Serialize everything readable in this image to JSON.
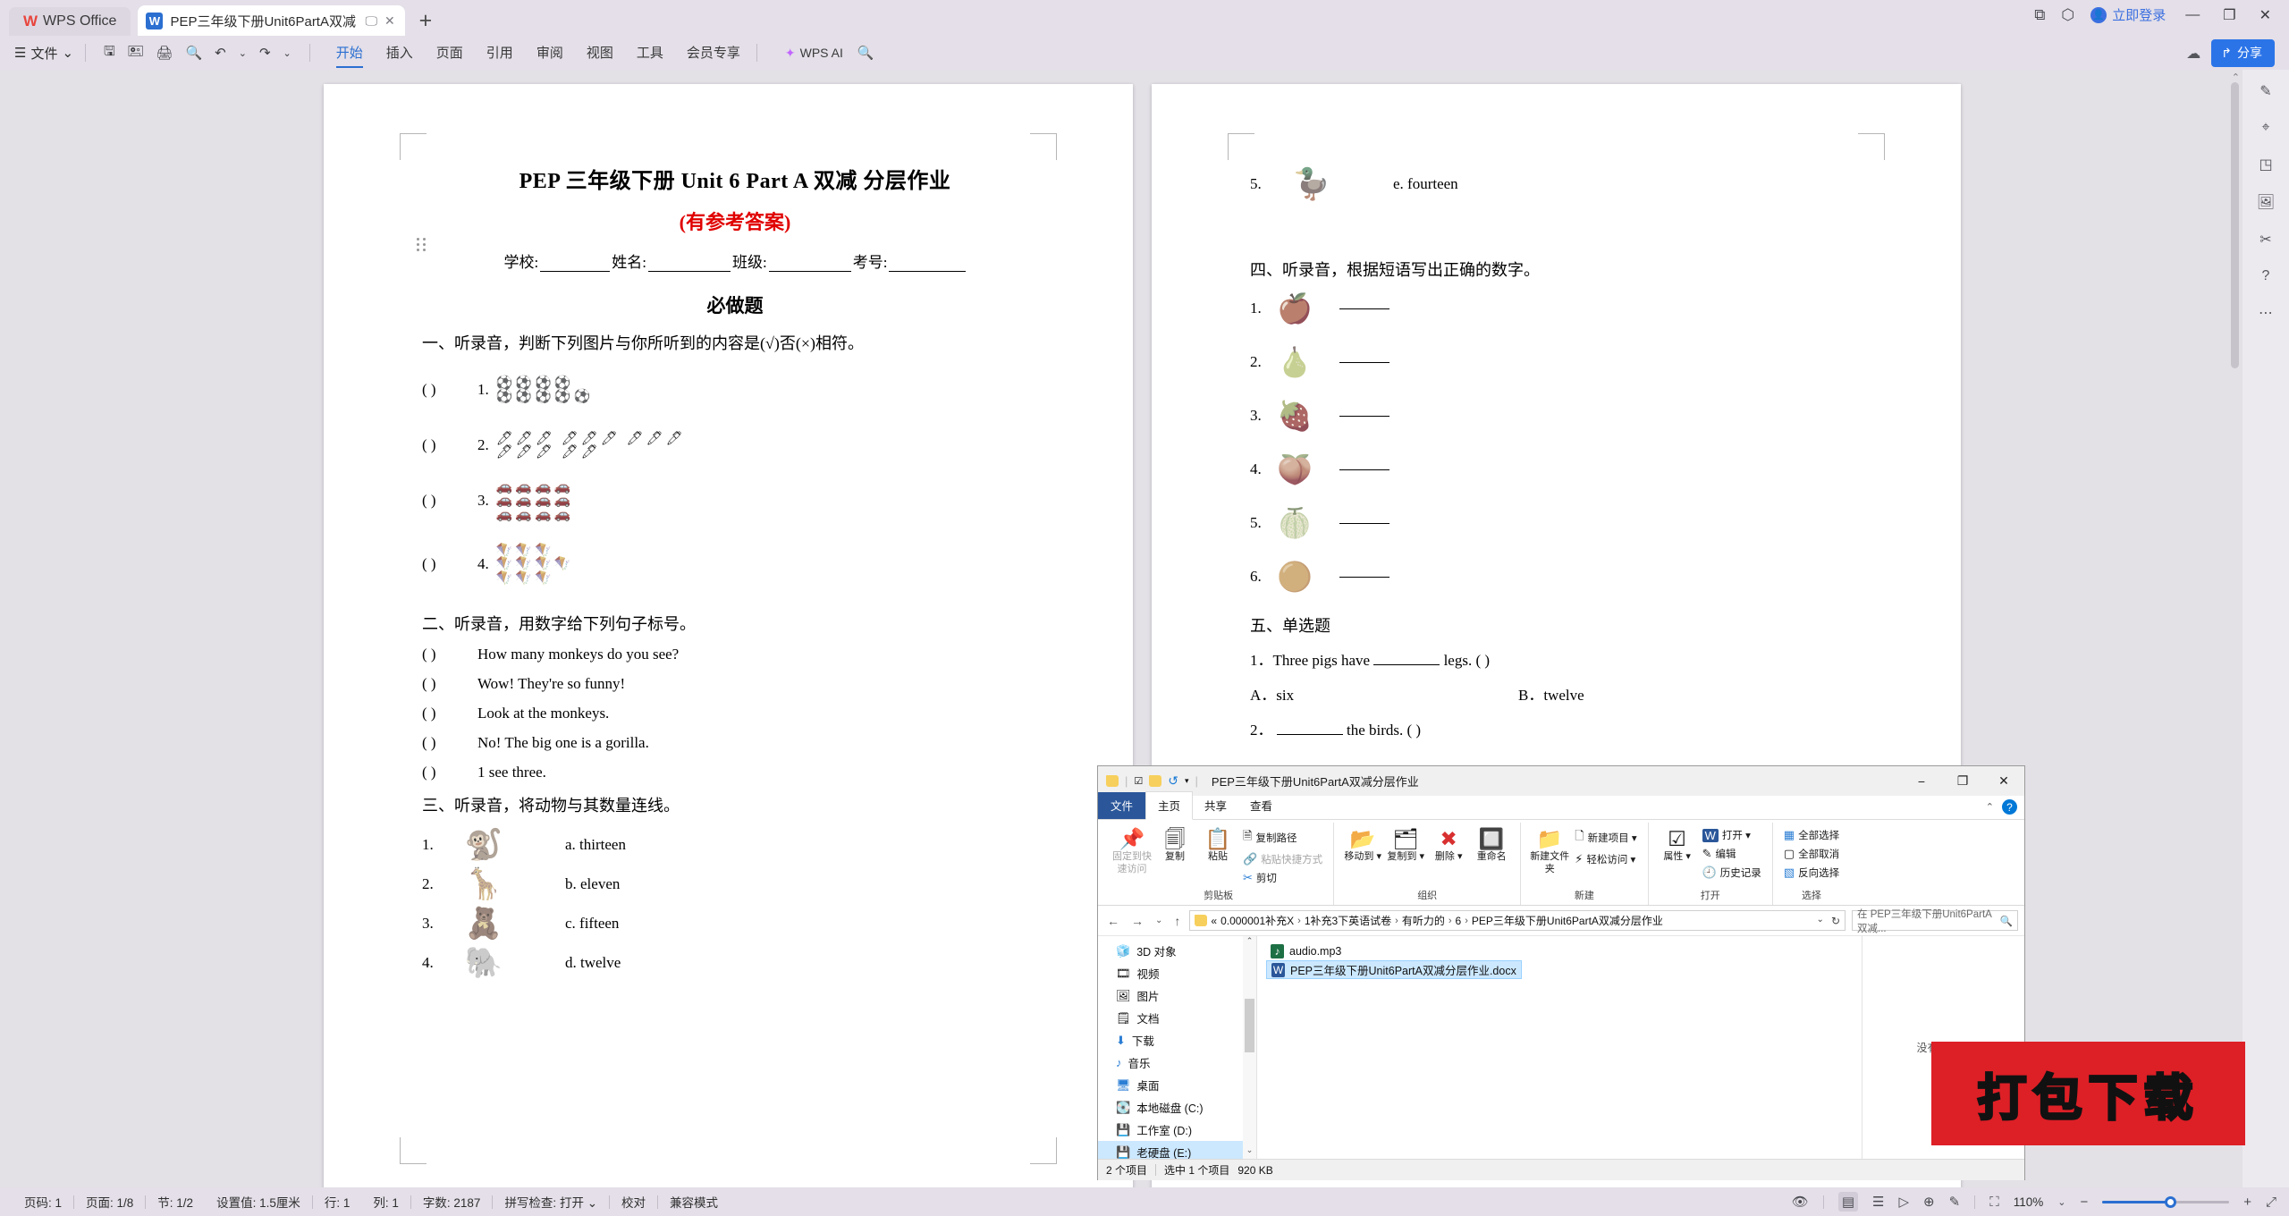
{
  "titlebar": {
    "brand": "WPS Office",
    "brand_logo": "W",
    "doc_tab": "PEP三年级下册Unit6PartA双减…",
    "tab_monitor_icon": "🖵",
    "tab_close_icon": "✕",
    "new_tab_icon": "+",
    "right_icons": [
      "⧉",
      "⬡"
    ],
    "login_label": "立即登录",
    "minimize": "—",
    "restore": "❐",
    "close": "✕"
  },
  "ribbon": {
    "file_menu": "文件",
    "quick_icons": [
      "save-icon",
      "save-as-icon",
      "print-icon",
      "print-preview-icon",
      "undo-icon",
      "redo-icon"
    ],
    "tabs": [
      {
        "label": "开始",
        "active": true
      },
      {
        "label": "插入",
        "active": false
      },
      {
        "label": "页面",
        "active": false
      },
      {
        "label": "引用",
        "active": false
      },
      {
        "label": "审阅",
        "active": false
      },
      {
        "label": "视图",
        "active": false
      },
      {
        "label": "工具",
        "active": false
      },
      {
        "label": "会员专享",
        "active": false
      }
    ],
    "ai_label": "WPS AI",
    "search_icon": "search-icon",
    "cloud_icon": "cloud-icon",
    "share_label": "分享"
  },
  "document": {
    "title": "PEP 三年级下册 Unit 6 Part A  双减  分层作业",
    "subtitle": "(有参考答案)",
    "info_fields": [
      "学校:",
      "姓名:",
      "班级:",
      "考号:"
    ],
    "section_required": "必做题",
    "q1_head": "一、听录音，判断下列图片与你所听到的内容是(√)否(×)相符。",
    "q1_items": [
      {
        "paren": "(        )",
        "num": "1.",
        "glyph": "⚽",
        "rows": [
          4,
          5
        ]
      },
      {
        "paren": "(        )",
        "num": "2.",
        "glyph": "🖊",
        "rows": [
          3,
          3,
          3,
          3,
          2
        ]
      },
      {
        "paren": "(        )",
        "num": "3.",
        "glyph": "🚗",
        "rows": [
          4,
          4,
          4
        ]
      },
      {
        "paren": "(        )",
        "num": "4.",
        "glyph": "🪁",
        "rows": [
          3,
          4,
          3
        ]
      }
    ],
    "q2_head": "二、听录音，用数字给下列句子标号。",
    "q2_items": [
      "How many monkeys do you see?",
      "Wow! They're so funny!",
      "Look at the monkeys.",
      "No! The big one is a gorilla.",
      "1 see three."
    ],
    "q2_paren": "(        )",
    "q3_head": "三、听录音，将动物与其数量连线。",
    "q3_left": [
      {
        "num": "1.",
        "pic": "monkey-icon",
        "glyph": "🐒"
      },
      {
        "num": "2.",
        "pic": "giraffe-icon",
        "glyph": "🦒"
      },
      {
        "num": "3.",
        "pic": "bear-icon",
        "glyph": "🧸"
      },
      {
        "num": "4.",
        "pic": "elephant-icon",
        "glyph": "🐘"
      },
      {
        "num": "5.",
        "pic": "duck-icon",
        "glyph": "🦆"
      }
    ],
    "q3_right": [
      "a. thirteen",
      "b. eleven",
      "c. fifteen",
      "d. twelve",
      "e. fourteen"
    ],
    "q4_head": "四、听录音，根据短语写出正确的数字。",
    "q4_items": [
      {
        "num": "1.",
        "pic": "apple-icon",
        "glyph": "🍎"
      },
      {
        "num": "2.",
        "pic": "pear-icon",
        "glyph": "🍐"
      },
      {
        "num": "3.",
        "pic": "strawberry-icon",
        "glyph": "🍓"
      },
      {
        "num": "4.",
        "pic": "peach-icon",
        "glyph": "🍑"
      },
      {
        "num": "5.",
        "pic": "watermelon-icon",
        "glyph": "🍈"
      },
      {
        "num": "6.",
        "pic": "orange-icon",
        "glyph": "🟠"
      }
    ],
    "q5_head": "五、单选题",
    "q5_q1": "1．Three pigs have",
    "q5_q1_tail": "legs. (    )",
    "q5_q1_a": "A．six",
    "q5_q1_b": "B．twelve",
    "q5_q2_num": "2．",
    "q5_q2_tail": "the birds. (    )"
  },
  "explorer": {
    "title": "PEP三年级下册Unit6PartA双减分层作业",
    "qat_icons": [
      "folder-icon",
      "properties-icon",
      "new-folder-icon",
      "undo-icon",
      "dropdown-icon"
    ],
    "min": "−",
    "max": "❐",
    "close": "✕",
    "tabs": [
      {
        "label": "文件",
        "kind": "file"
      },
      {
        "label": "主页",
        "kind": "selected"
      },
      {
        "label": "共享",
        "kind": "normal"
      },
      {
        "label": "查看",
        "kind": "normal"
      }
    ],
    "collapse_icon": "⌃",
    "help_icon": "?",
    "ribbon_groups": [
      {
        "label": "剪贴板",
        "big": [
          {
            "icon": "📌",
            "label": "固定到快速访问",
            "dim": true
          },
          {
            "icon": "📄",
            "label": "复制"
          },
          {
            "icon": "📋",
            "label": "粘贴"
          }
        ],
        "small": [
          {
            "icon": "🗐",
            "label": "复制路径"
          },
          {
            "icon": "🔗",
            "label": "粘贴快捷方式",
            "dim": true
          },
          {
            "icon": "✂",
            "label": "剪切"
          }
        ]
      },
      {
        "label": "组织",
        "big": [
          {
            "icon": "⬅",
            "label": "移动到 ▾"
          },
          {
            "icon": "📑",
            "label": "复制到 ▾"
          },
          {
            "icon": "✖",
            "label": "删除 ▾"
          },
          {
            "icon": "🔲",
            "label": "重命名"
          }
        ],
        "small": []
      },
      {
        "label": "新建",
        "big": [
          {
            "icon": "📁",
            "label": "新建文件夹"
          }
        ],
        "small": [
          {
            "icon": "🗋",
            "label": "新建项目 ▾"
          },
          {
            "icon": "⚡",
            "label": "轻松访问 ▾"
          }
        ]
      },
      {
        "label": "打开",
        "big": [
          {
            "icon": "☑",
            "label": "属性 ▾"
          }
        ],
        "small": [
          {
            "icon": "W",
            "label": "打开 ▾"
          },
          {
            "icon": "✎",
            "label": "编辑"
          },
          {
            "icon": "🕘",
            "label": "历史记录"
          }
        ]
      },
      {
        "label": "选择",
        "big": [],
        "small": [
          {
            "icon": "▦",
            "label": "全部选择"
          },
          {
            "icon": "▢",
            "label": "全部取消"
          },
          {
            "icon": "▧",
            "label": "反向选择"
          }
        ]
      }
    ],
    "nav": {
      "back": "←",
      "forward": "→",
      "recent": "⌄",
      "up": "↑",
      "crumb_prefix": "«",
      "crumbs": [
        "0.000001补充X",
        "1补充3下英语试卷",
        "有听力的",
        "6",
        "PEP三年级下册Unit6PartA双减分层作业"
      ],
      "dropdown": "⌄",
      "refresh": "↻",
      "search_placeholder": "在 PEP三年级下册Unit6PartA双减...",
      "search_icon": "search-icon"
    },
    "navpane_items": [
      {
        "icon": "🧊",
        "label": "3D 对象"
      },
      {
        "icon": "🎞",
        "label": "视频"
      },
      {
        "icon": "🖼",
        "label": "图片"
      },
      {
        "icon": "📄",
        "label": "文档"
      },
      {
        "icon": "⬇",
        "label": "下载"
      },
      {
        "icon": "♪",
        "label": "音乐"
      },
      {
        "icon": "🖥",
        "label": "桌面"
      },
      {
        "icon": "💽",
        "label": "本地磁盘 (C:)"
      },
      {
        "icon": "💾",
        "label": "工作室 (D:)"
      },
      {
        "icon": "💾",
        "label": "老硬盘 (E:)",
        "selected": true
      }
    ],
    "files": [
      {
        "name": "audio.mp3",
        "type": "mp3",
        "icon_letter": "♪",
        "selected": false
      },
      {
        "name": "PEP三年级下册Unit6PartA双减分层作业.docx",
        "type": "doc",
        "icon_letter": "W",
        "selected": true
      }
    ],
    "preview_text": "没有预览。",
    "status_count": "2 个项目",
    "status_selected": "选中 1 个项目",
    "status_size": "920 KB"
  },
  "watermark": {
    "text": "打包下载"
  },
  "statusbar": {
    "items": [
      "页码: 1",
      "页面: 1/8",
      "节: 1/2",
      "设置值: 1.5厘米",
      "行: 1",
      "列: 1",
      "字数: 2187",
      "拼写检查: 打开 ⌄",
      "校对",
      "兼容模式"
    ],
    "right_icons": [
      "eye-icon",
      "page-view-icon",
      "outline-view-icon",
      "play-icon",
      "web-view-icon",
      "highlighter-icon",
      "focus-icon"
    ],
    "zoom": "110%",
    "zoom_out": "−",
    "zoom_in": "+",
    "fullscreen_icon": "⤢"
  },
  "rail": {
    "icons": [
      "scroll-up-icon",
      "pen-icon",
      "cursor-icon",
      "shapes-icon",
      "image-icon",
      "scissors-icon",
      "help-icon",
      "more-icon"
    ]
  }
}
